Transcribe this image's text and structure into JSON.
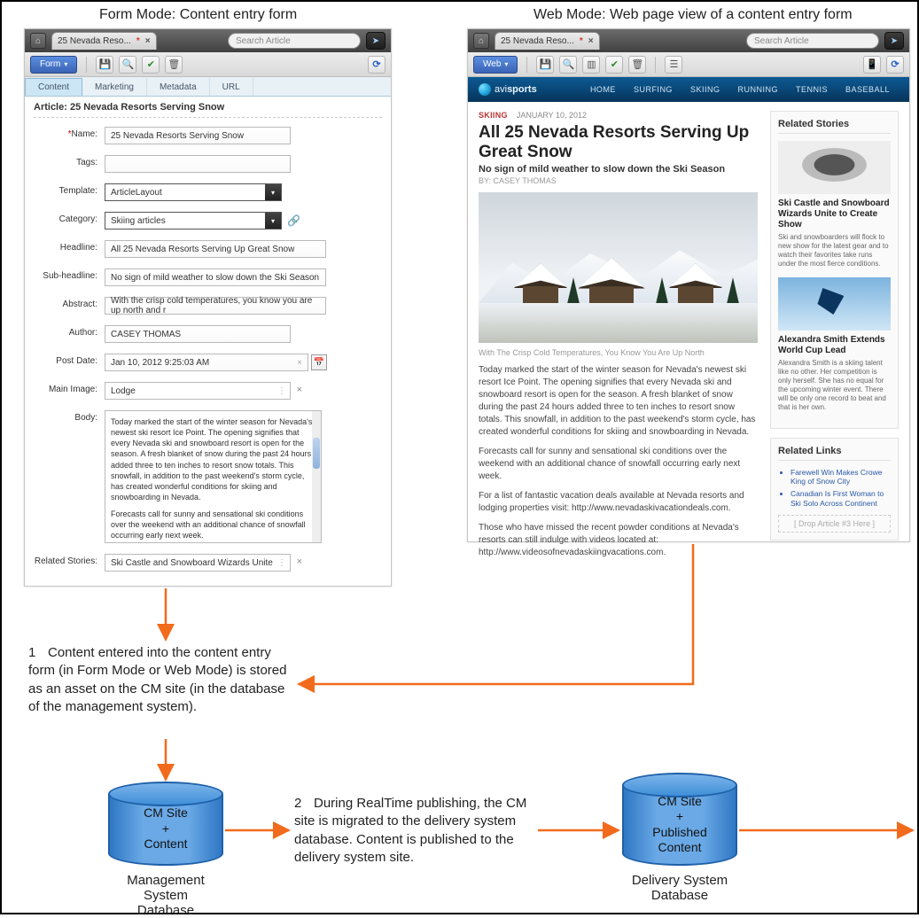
{
  "captions": {
    "form": "Form Mode: Content entry form",
    "web": "Web Mode: Web page view of a content entry form"
  },
  "chrome": {
    "tab_label": "25 Nevada Reso...",
    "search_placeholder": "Search Article"
  },
  "form_mode": {
    "mode_button": "Form",
    "tabs": {
      "content": "Content",
      "marketing": "Marketing",
      "metadata": "Metadata",
      "url": "URL"
    },
    "title_line": "Article: 25 Nevada Resorts Serving Snow",
    "labels": {
      "name": "Name:",
      "tags": "Tags:",
      "template": "Template:",
      "category": "Category:",
      "headline": "Headline:",
      "subheadline": "Sub-headline:",
      "abstract": "Abstract:",
      "author": "Author:",
      "postdate": "Post Date:",
      "mainimage": "Main Image:",
      "body": "Body:",
      "related": "Related Stories:"
    },
    "values": {
      "name": "25 Nevada Resorts Serving Snow",
      "tags": "",
      "template": "ArticleLayout",
      "category": "Skiing articles",
      "headline": "All 25 Nevada Resorts Serving Up Great Snow",
      "subheadline": "No sign of mild weather to slow down the Ski Season",
      "abstract": "With the crisp cold temperatures, you know you are up north and r",
      "author": "CASEY THOMAS",
      "postdate": "Jan 10, 2012 9:25:03 AM",
      "mainimage": "Lodge",
      "related": "Ski Castle and Snowboard Wizards Unite"
    },
    "body_paragraphs": [
      "Today marked the start of the winter season for Nevada's newest ski resort Ice Point. The opening signifies that every Nevada ski and snowboard resort is open for the season. A fresh blanket of snow during the past 24 hours added three to ten inches to resort snow totals. This snowfall, in addition to the past weekend's storm cycle, has created wonderful conditions for skiing and snowboarding in Nevada.",
      "Forecasts call for sunny and sensational ski conditions over the weekend with an additional chance of snowfall occurring early next week.",
      "For a list of fantastic vacation deals available at Nevada resorts and lodging properties visit: http://www.nevadaskivacationdeals.com.",
      "Those who have missed the recent powder conditions at Nevada's resorts can still"
    ]
  },
  "web_mode": {
    "mode_button": "Web",
    "brand_a": "avi",
    "brand_b": "sports",
    "nav": {
      "home": "HOME",
      "surfing": "SURFING",
      "skiing": "SKIING",
      "running": "RUNNING",
      "tennis": "TENNIS",
      "baseball": "BASEBALL"
    },
    "meta_cat": "SKIING",
    "meta_date": "JANUARY 10, 2012",
    "title": "All 25 Nevada Resorts Serving Up Great Snow",
    "subhead": "No sign of mild weather to slow down the Ski Season",
    "byline": "BY: CASEY THOMAS",
    "caption": "With The Crisp Cold Temperatures, You Know You Are Up North",
    "paragraphs": [
      "Today marked the start of the winter season for Nevada's newest ski resort Ice Point. The opening signifies that every Nevada ski and snowboard resort is open for the season. A fresh blanket of snow during the past 24 hours added three to ten inches to resort snow totals. This snowfall, in addition to the past weekend's storm cycle, has created wonderful conditions for skiing and snowboarding in Nevada.",
      "Forecasts call for sunny and sensational ski conditions over the weekend with an additional chance of snowfall occurring early next week.",
      "For a list of fantastic vacation deals available at Nevada resorts and lodging properties visit: http://www.nevadaskivacationdeals.com.",
      "Those who have missed the recent powder conditions at Nevada's resorts can still indulge with videos located at: http://www.videosofnevadaskiingvacations.com."
    ],
    "related_stories_header": "Related Stories",
    "story1_title": "Ski Castle and Snowboard Wizards Unite to Create Show",
    "story1_blurb": "Ski and snowboarders will flock to new show for the latest gear and to watch their favorites take runs under the most fierce conditions.",
    "story2_title": "Alexandra Smith Extends World Cup Lead",
    "story2_blurb": "Alexandra Smith is a skiing talent like no other. Her competition is only herself. She has no equal for the upcoming winter event. There will be only one record to beat and that is her own.",
    "related_links_header": "Related Links",
    "link1": "Farewell Win Makes Crowe King of Snow City",
    "link2": "Canadian Is First Woman to Ski Solo Across Continent",
    "drop": "[ Drop Article #3 Here ]"
  },
  "steps": {
    "s1": "Content entered into the content entry form (in Form Mode or Web Mode) is stored as an asset on the CM site (in the database of the management system).",
    "s2": "During RealTime publishing, the CM site is migrated to the delivery system database. Content is published to the delivery system site."
  },
  "databases": {
    "cm": "CM Site\n+\nContent",
    "cm_label": "Management System\nDatabase",
    "del": "CM Site\n+\nPublished\nContent",
    "del_label": "Delivery System Database"
  }
}
